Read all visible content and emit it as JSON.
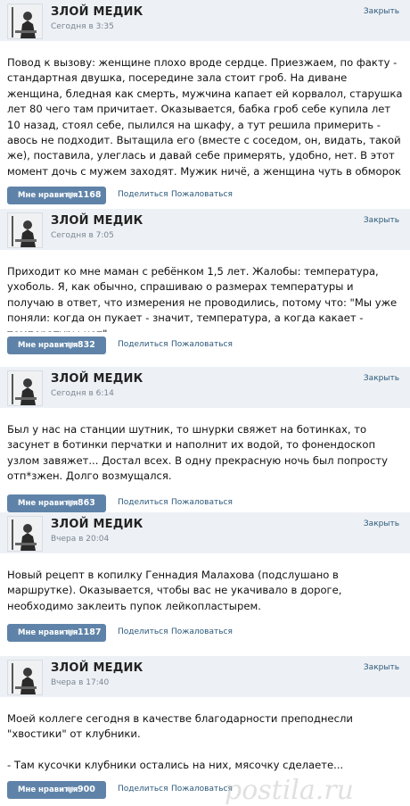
{
  "posts": [
    {
      "author": "ЗЛОЙ МЕДИК",
      "time": "Сегодня в 3:35",
      "close": "Закрыть",
      "text": "Повод к вызову: женщине плохо вроде сердце. Приезжаем, по факту - стандартная двушка, посередине зала стоит гроб. На диване женщина, бледная как смерть, мужчина капает ей корвалол, старушка лет 80 чего там причитает. Оказывается, бабка гроб себе купила лет 10 назад, стоял себе, пылился на шкафу, а тут решила примерить -  авось не подходит. Вытащила его (вместе с соседом, он, видать, такой же), поставила, улеглась и давай себе примерять, удобно, нет. В этот момент дочь с мужем заходят. Мужик ничё, а женщина чуть в обморок не упала.",
      "like_label": "Мне нравится",
      "likes": "1168",
      "share": "Поделиться",
      "complain": "Пожаловаться"
    },
    {
      "author": "ЗЛОЙ МЕДИК",
      "time": "Сегодня в 7:05",
      "close": "Закрыть",
      "text": "Приходит ко мне маман с ребёнком 1,5 лет. Жалобы: температура, ухоболь. Я, как обычно, спрашиваю о размерах температуры и получаю в ответ, что измерения не проводились, потому что: \"Мы уже поняли: когда он пукает - значит, температура, а когда какает - температуры нет\".",
      "like_label": "Мне нравится",
      "likes": "832",
      "share": "Поделиться",
      "complain": "Пожаловаться"
    },
    {
      "author": "ЗЛОЙ МЕДИК",
      "time": "Сегодня в 6:14",
      "close": "Закрыть",
      "text": "Был у нас на станции шутник, то шнурки свяжет на ботинках, то засунет в ботинки перчатки и наполнит их водой, то фонендоскоп узлом завяжет... Достал всех. В одну прекрасную ночь был попросту отп*зжен. Долго возмущался.",
      "like_label": "Мне нравится",
      "likes": "863",
      "share": "Поделиться",
      "complain": "Пожаловаться"
    },
    {
      "author": "ЗЛОЙ МЕДИК",
      "time": "Вчера в 20:04",
      "close": "Закрыть",
      "text": "Новый рецепт в копилку Геннадия Малахова (подслушано в маршрутке). Оказывается, чтобы вас не укачивало в дороге, необходимо заклеить пупок лейкопластырем.",
      "like_label": "Мне нравится",
      "likes": "1187",
      "share": "Поделиться",
      "complain": "Пожаловаться"
    },
    {
      "author": "ЗЛОЙ МЕДИК",
      "time": "Вчера в 17:40",
      "close": "Закрыть",
      "text": "Моей коллеге сегодня в качестве благодарности преподнесли \"хвостики\" от клубники.\n\n- Там кусочки клубники остались на них, мясочку сделаете...",
      "like_label": "Мне нравится",
      "likes": "900",
      "share": "Поделиться",
      "complain": "Пожаловаться"
    }
  ],
  "watermark": "postila.ru",
  "icons": {
    "like": "heart-icon",
    "avatar": "avatar-icon"
  },
  "colors": {
    "header_bg": "#edf1f5",
    "like_button": "#5f83a8",
    "link": "#2b587a"
  }
}
